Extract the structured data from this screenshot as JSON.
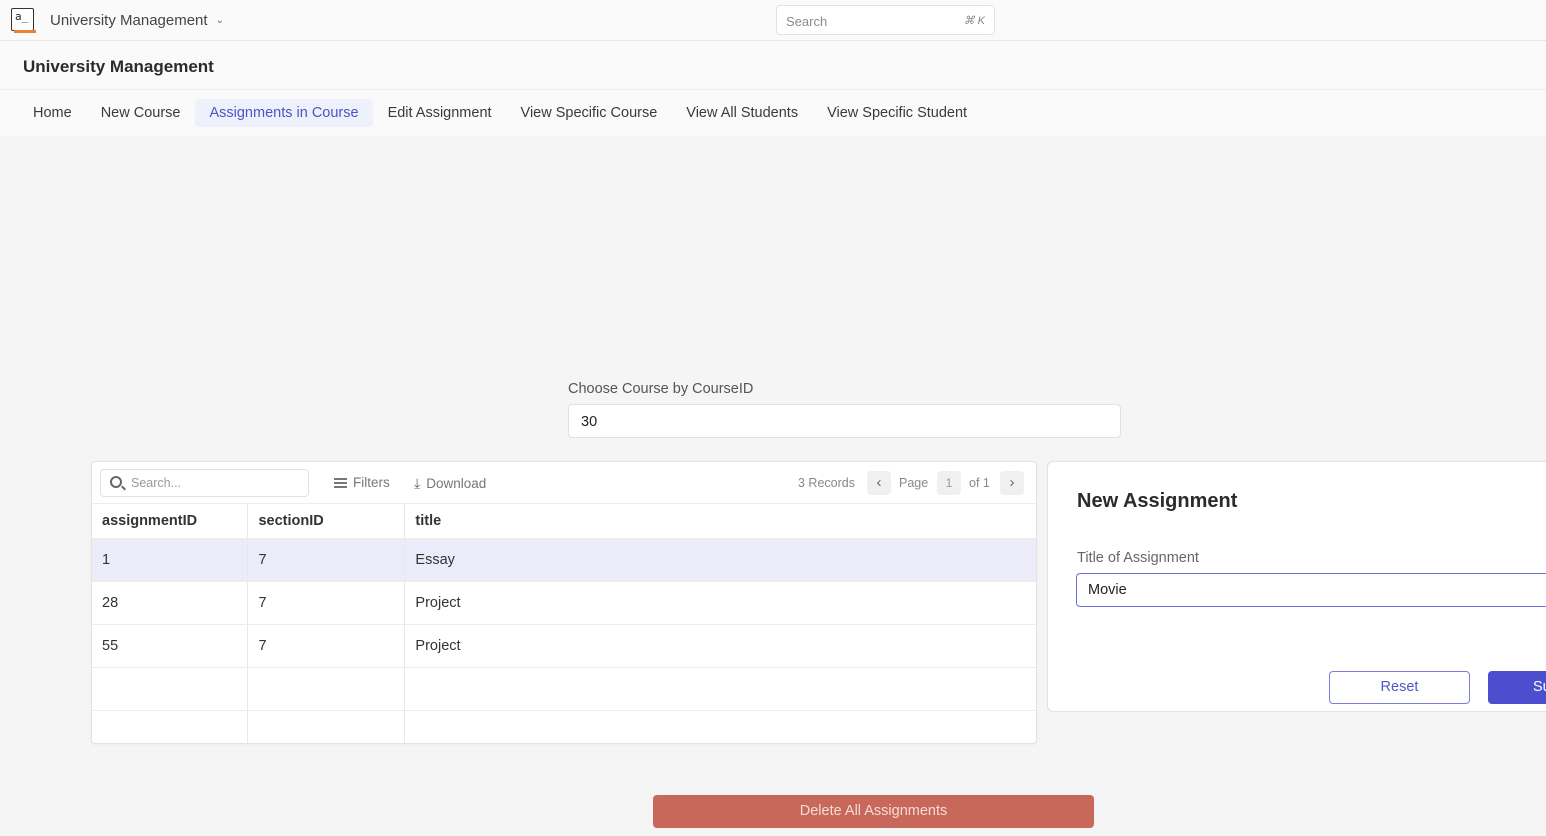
{
  "topbar": {
    "logo_text": "a_",
    "app_name": "University Management",
    "search_placeholder": "Search",
    "search_shortcut": "⌘ K"
  },
  "header": {
    "title": "University Management"
  },
  "nav": {
    "items": [
      {
        "label": "Home"
      },
      {
        "label": "New Course"
      },
      {
        "label": "Assignments in Course",
        "active": true
      },
      {
        "label": "Edit Assignment"
      },
      {
        "label": "View Specific Course"
      },
      {
        "label": "View All Students"
      },
      {
        "label": "View Specific Student"
      }
    ]
  },
  "course_selector": {
    "label": "Choose Course by CourseID",
    "value": "30"
  },
  "table": {
    "search_placeholder": "Search...",
    "filters_label": "Filters",
    "download_label": "Download",
    "records": "3 Records",
    "page_label": "Page",
    "page_current": "1",
    "page_of": "of 1",
    "columns": [
      "assignmentID",
      "sectionID",
      "title"
    ],
    "rows": [
      [
        "1",
        "7",
        "Essay"
      ],
      [
        "28",
        "7",
        "Project"
      ],
      [
        "55",
        "7",
        "Project"
      ],
      [
        "",
        "",
        ""
      ],
      [
        "",
        "",
        ""
      ]
    ],
    "selected_row": 0
  },
  "form": {
    "title": "New Assignment",
    "field_label": "Title of Assignment",
    "field_value": "Movie",
    "reset_label": "Reset",
    "submit_label": "Su"
  },
  "delete_button": {
    "label": "Delete All Assignments"
  },
  "colors": {
    "accent": "#4b55c4",
    "selected_row": "#ecebfa",
    "submit": "#4b4fcf",
    "delete": "#c8685a"
  }
}
